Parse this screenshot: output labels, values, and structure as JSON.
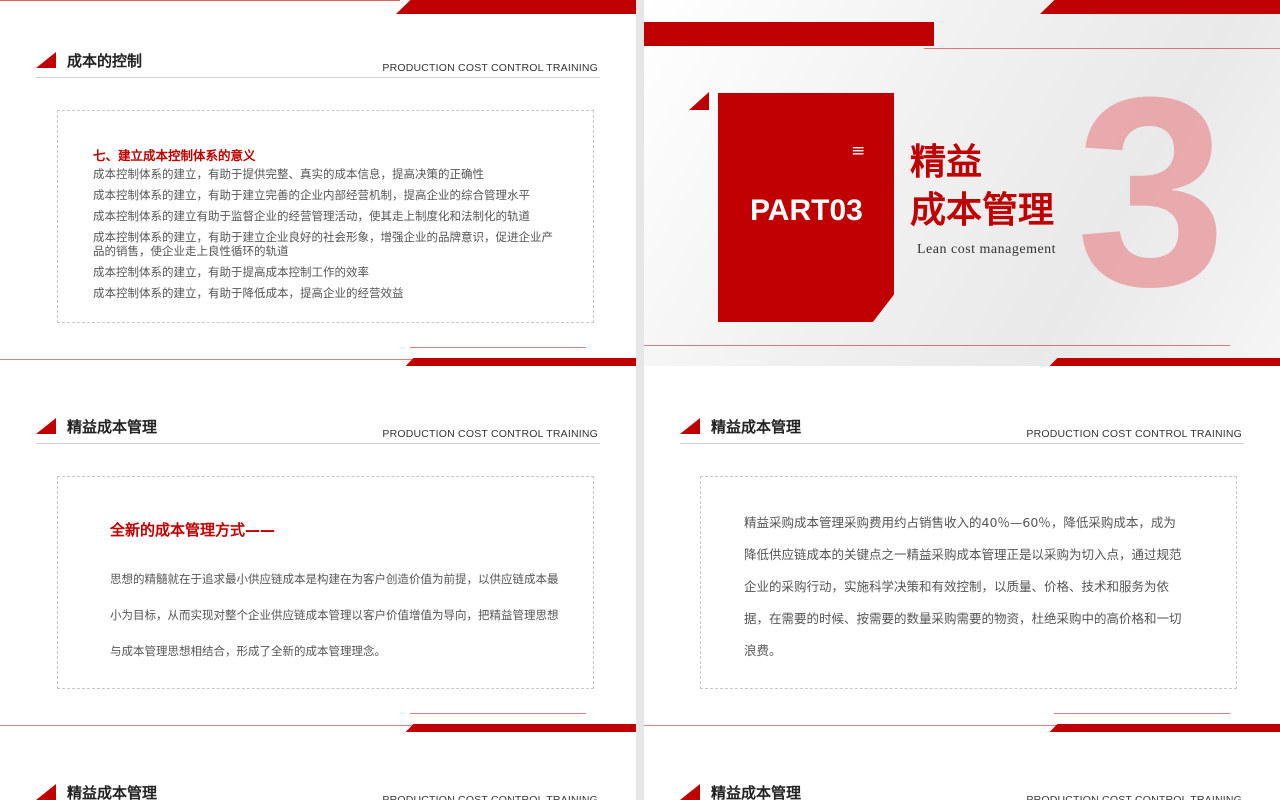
{
  "common": {
    "subtitle_en": "PRODUCTION COST CONTROL TRAINING"
  },
  "slide1": {
    "title": "成本的控制",
    "heading": "七、建立成本控制体系的意义",
    "items": [
      "成本控制体系的建立，有助于提供完整、真实的成本信息，提高决策的正确性",
      "成本控制体系的建立，有助于建立完善的企业内部经营机制，提高企业的综合管理水平",
      "成本控制体系的建立有助于监督企业的经营管理活动，使其走上制度化和法制化的轨道",
      "成本控制体系的建立，有助于建立企业良好的社会形象，增强企业的品牌意识，促进企业产品的销售，使企业走上良性循环的轨道",
      "成本控制体系的建立，有助于提高成本控制工作的效率",
      "成本控制体系的建立，有助于降低成本，提高企业的经营效益"
    ]
  },
  "slide2": {
    "icon": "menu-icon",
    "menu_glyph": "≡",
    "part": "PART03",
    "title_line1": "精益",
    "title_line2": "成本管理",
    "subtitle_en": "Lean cost management",
    "big_number": "3"
  },
  "slide3": {
    "title": "精益成本管理",
    "heading": "全新的成本管理方式——",
    "paragraph": "思想的精髓就在于追求最小供应链成本是构建在为客户创造价值为前提，以供应链成本最小为目标，从而实现对整个企业供应链成本管理以客户价值增值为导向，把精益管理思想与成本管理思想相结合，形成了全新的成本管理理念。"
  },
  "slide4": {
    "title": "精益成本管理",
    "paragraph": "精益采购成本管理采购费用约占销售收入的40％—60％，降低采购成本，成为降低供应链成本的关键点之一精益采购成本管理正是以采购为切入点，通过规范企业的采购行动，实施科学决策和有效控制，以质量、价格、技术和服务为依据，在需要的时候、按需要的数量采购需要的物资，杜绝采购中的高价格和一切浪费。"
  },
  "slide5": {
    "title": "精益成本管理"
  },
  "slide6": {
    "title": "精益成本管理"
  },
  "colors": {
    "brand_red": "#c00000",
    "number_pink": "#e8a3a6"
  }
}
